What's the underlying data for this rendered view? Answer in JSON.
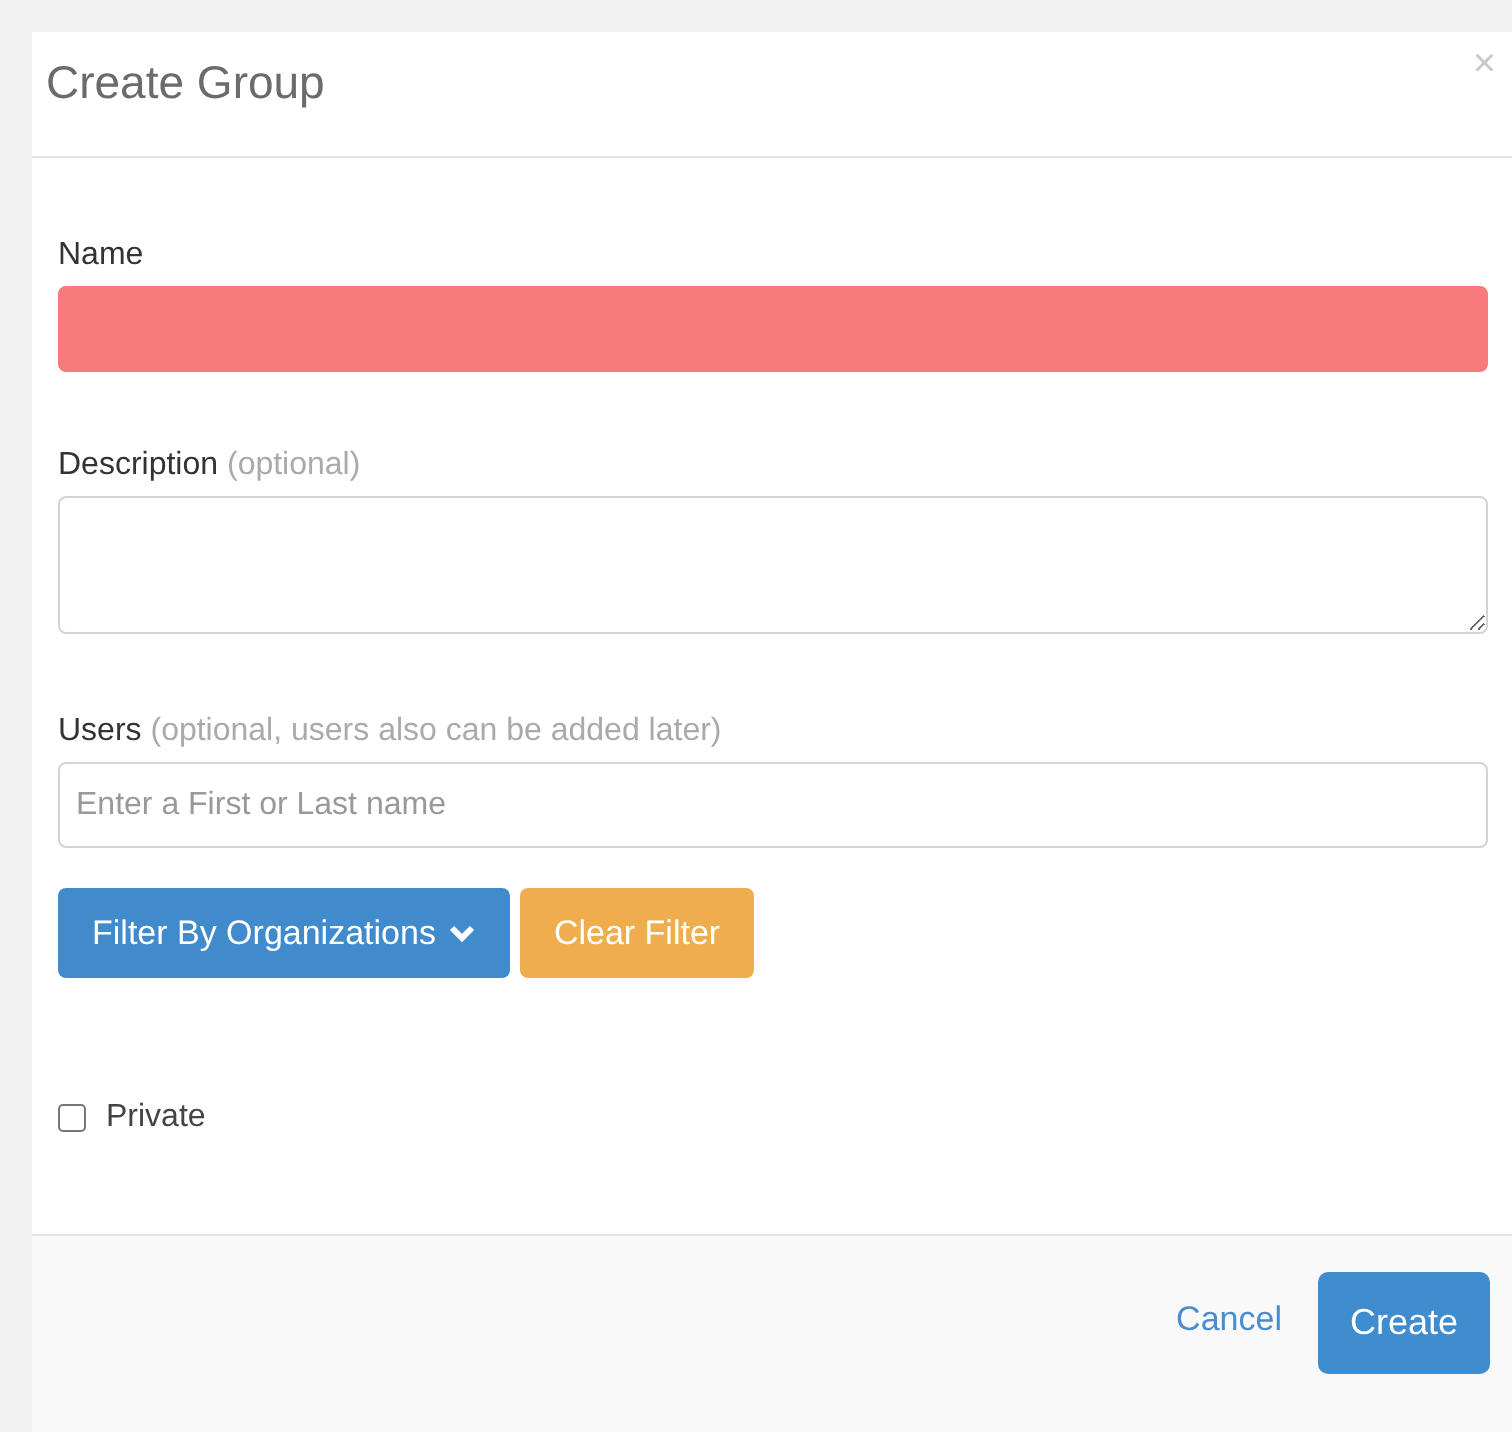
{
  "dialog": {
    "title": "Create Group",
    "close": "×"
  },
  "fields": [
    {
      "kind": "input",
      "label": "Name",
      "invalid": true
    },
    {
      "kind": "textarea",
      "label": "Description",
      "hint": "(optional)",
      "invalid": false
    },
    {
      "kind": "input",
      "label": "Users",
      "hint": "(optional, users also can be added later)",
      "placeholder": "Enter a First or Last name",
      "invalid": false
    }
  ],
  "filter_buttons": [
    {
      "kind": "dropdown",
      "label": "Filter By Organizations"
    },
    {
      "kind": "warning",
      "label": "Clear Filter"
    }
  ],
  "private": {
    "label": "Private",
    "checked": false
  },
  "footer": {
    "cancel": "Cancel",
    "submit": "Create"
  }
}
